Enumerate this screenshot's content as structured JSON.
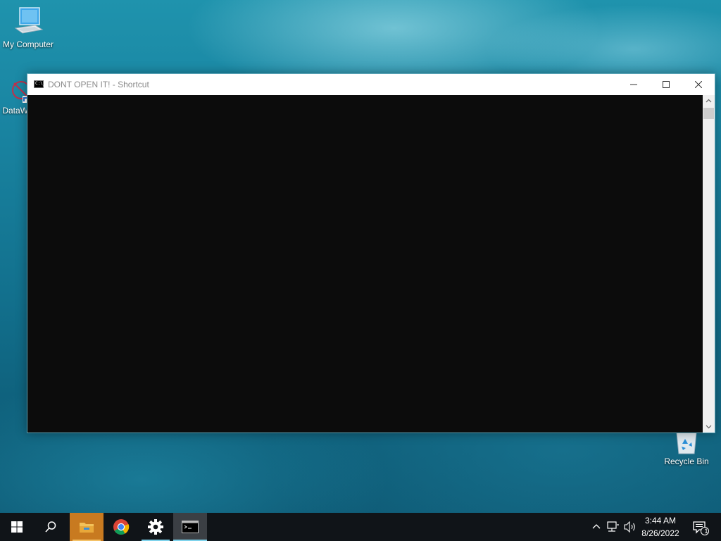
{
  "desktop": {
    "icons": [
      {
        "label": "My Computer"
      },
      {
        "label": "DataW"
      },
      {
        "label": "Recycle Bin"
      }
    ]
  },
  "window": {
    "title": "DONT OPEN IT! - Shortcut",
    "icon_text": "C:\\_",
    "body_color": "#0c0c0c"
  },
  "taskbar": {
    "items": [
      "start",
      "search",
      "file-explorer",
      "chrome",
      "settings",
      "command-prompt"
    ],
    "clock": {
      "time": "3:44 AM",
      "date": "8/26/2022"
    },
    "notification_count": "1"
  }
}
